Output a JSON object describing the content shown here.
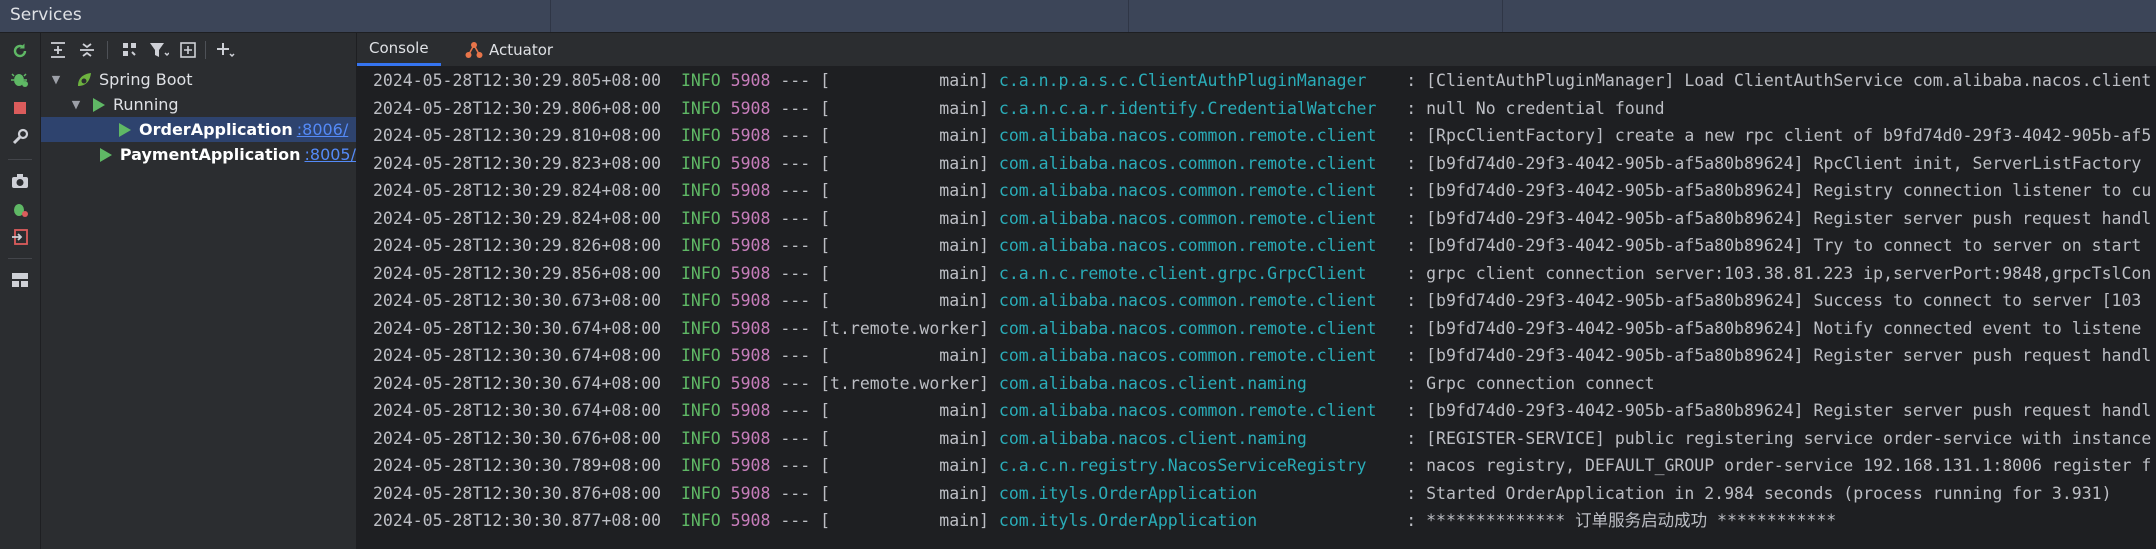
{
  "window": {
    "title": "Services"
  },
  "tree_toolbar": {
    "icons": [
      "expand-all-icon",
      "collapse-all-icon",
      "group-by-icon",
      "filter-icon",
      "new-tab-icon",
      "add-icon"
    ]
  },
  "left_tools": {
    "icons": [
      "rerun-icon",
      "debug-icon",
      "stop-icon",
      "settings-icon",
      "screenshot-icon",
      "debug-services-icon",
      "import-icon",
      "layout-icon"
    ]
  },
  "tree": {
    "root": "Spring Boot",
    "group": "Running",
    "apps": [
      {
        "name": "OrderApplication",
        "port": ":8006/",
        "selected": true
      },
      {
        "name": "PaymentApplication",
        "port": ":8005/",
        "selected": false
      }
    ]
  },
  "tabs": [
    {
      "label": "Console",
      "active": true
    },
    {
      "label": "Actuator",
      "active": false
    }
  ],
  "log": [
    {
      "ts": "2024-05-28T12:30:29.805+08:00",
      "level": "INFO",
      "pid": "5908",
      "sep": "---",
      "thread": "[           main]",
      "logger": "c.a.n.p.a.s.c.ClientAuthPluginManager   ",
      "msg": ": [ClientAuthPluginManager] Load ClientAuthService com.alibaba.nacos.client"
    },
    {
      "ts": "2024-05-28T12:30:29.806+08:00",
      "level": "INFO",
      "pid": "5908",
      "sep": "---",
      "thread": "[           main]",
      "logger": "c.a.n.c.a.r.identify.CredentialWatcher  ",
      "msg": ": null No credential found"
    },
    {
      "ts": "2024-05-28T12:30:29.810+08:00",
      "level": "INFO",
      "pid": "5908",
      "sep": "---",
      "thread": "[           main]",
      "logger": "com.alibaba.nacos.common.remote.client  ",
      "msg": ": [RpcClientFactory] create a new rpc client of b9fd74d0-29f3-4042-905b-af5"
    },
    {
      "ts": "2024-05-28T12:30:29.823+08:00",
      "level": "INFO",
      "pid": "5908",
      "sep": "---",
      "thread": "[           main]",
      "logger": "com.alibaba.nacos.common.remote.client  ",
      "msg": ": [b9fd74d0-29f3-4042-905b-af5a80b89624] RpcClient init, ServerListFactory"
    },
    {
      "ts": "2024-05-28T12:30:29.824+08:00",
      "level": "INFO",
      "pid": "5908",
      "sep": "---",
      "thread": "[           main]",
      "logger": "com.alibaba.nacos.common.remote.client  ",
      "msg": ": [b9fd74d0-29f3-4042-905b-af5a80b89624] Registry connection listener to cu"
    },
    {
      "ts": "2024-05-28T12:30:29.824+08:00",
      "level": "INFO",
      "pid": "5908",
      "sep": "---",
      "thread": "[           main]",
      "logger": "com.alibaba.nacos.common.remote.client  ",
      "msg": ": [b9fd74d0-29f3-4042-905b-af5a80b89624] Register server push request handl"
    },
    {
      "ts": "2024-05-28T12:30:29.826+08:00",
      "level": "INFO",
      "pid": "5908",
      "sep": "---",
      "thread": "[           main]",
      "logger": "com.alibaba.nacos.common.remote.client  ",
      "msg": ": [b9fd74d0-29f3-4042-905b-af5a80b89624] Try to connect to server on start"
    },
    {
      "ts": "2024-05-28T12:30:29.856+08:00",
      "level": "INFO",
      "pid": "5908",
      "sep": "---",
      "thread": "[           main]",
      "logger": "c.a.n.c.remote.client.grpc.GrpcClient   ",
      "msg": ": grpc client connection server:103.38.81.223 ip,serverPort:9848,grpcTslCon"
    },
    {
      "ts": "2024-05-28T12:30:30.673+08:00",
      "level": "INFO",
      "pid": "5908",
      "sep": "---",
      "thread": "[           main]",
      "logger": "com.alibaba.nacos.common.remote.client  ",
      "msg": ": [b9fd74d0-29f3-4042-905b-af5a80b89624] Success to connect to server [103"
    },
    {
      "ts": "2024-05-28T12:30:30.674+08:00",
      "level": "INFO",
      "pid": "5908",
      "sep": "---",
      "thread": "[t.remote.worker]",
      "logger": "com.alibaba.nacos.common.remote.client  ",
      "msg": ": [b9fd74d0-29f3-4042-905b-af5a80b89624] Notify connected event to listene"
    },
    {
      "ts": "2024-05-28T12:30:30.674+08:00",
      "level": "INFO",
      "pid": "5908",
      "sep": "---",
      "thread": "[           main]",
      "logger": "com.alibaba.nacos.common.remote.client  ",
      "msg": ": [b9fd74d0-29f3-4042-905b-af5a80b89624] Register server push request handl"
    },
    {
      "ts": "2024-05-28T12:30:30.674+08:00",
      "level": "INFO",
      "pid": "5908",
      "sep": "---",
      "thread": "[t.remote.worker]",
      "logger": "com.alibaba.nacos.client.naming         ",
      "msg": ": Grpc connection connect"
    },
    {
      "ts": "2024-05-28T12:30:30.674+08:00",
      "level": "INFO",
      "pid": "5908",
      "sep": "---",
      "thread": "[           main]",
      "logger": "com.alibaba.nacos.common.remote.client  ",
      "msg": ": [b9fd74d0-29f3-4042-905b-af5a80b89624] Register server push request handl"
    },
    {
      "ts": "2024-05-28T12:30:30.676+08:00",
      "level": "INFO",
      "pid": "5908",
      "sep": "---",
      "thread": "[           main]",
      "logger": "com.alibaba.nacos.client.naming         ",
      "msg": ": [REGISTER-SERVICE] public registering service order-service with instance"
    },
    {
      "ts": "2024-05-28T12:30:30.789+08:00",
      "level": "INFO",
      "pid": "5908",
      "sep": "---",
      "thread": "[           main]",
      "logger": "c.a.c.n.registry.NacosServiceRegistry   ",
      "msg": ": nacos registry, DEFAULT_GROUP order-service 192.168.131.1:8006 register f"
    },
    {
      "ts": "2024-05-28T12:30:30.876+08:00",
      "level": "INFO",
      "pid": "5908",
      "sep": "---",
      "thread": "[           main]",
      "logger": "com.ityls.OrderApplication              ",
      "msg": ": Started OrderApplication in 2.984 seconds (process running for 3.931)"
    },
    {
      "ts": "2024-05-28T12:30:30.877+08:00",
      "level": "INFO",
      "pid": "5908",
      "sep": "---",
      "thread": "[           main]",
      "logger": "com.ityls.OrderApplication              ",
      "msg": ": ************** 订单服务启动成功 ************"
    }
  ]
}
